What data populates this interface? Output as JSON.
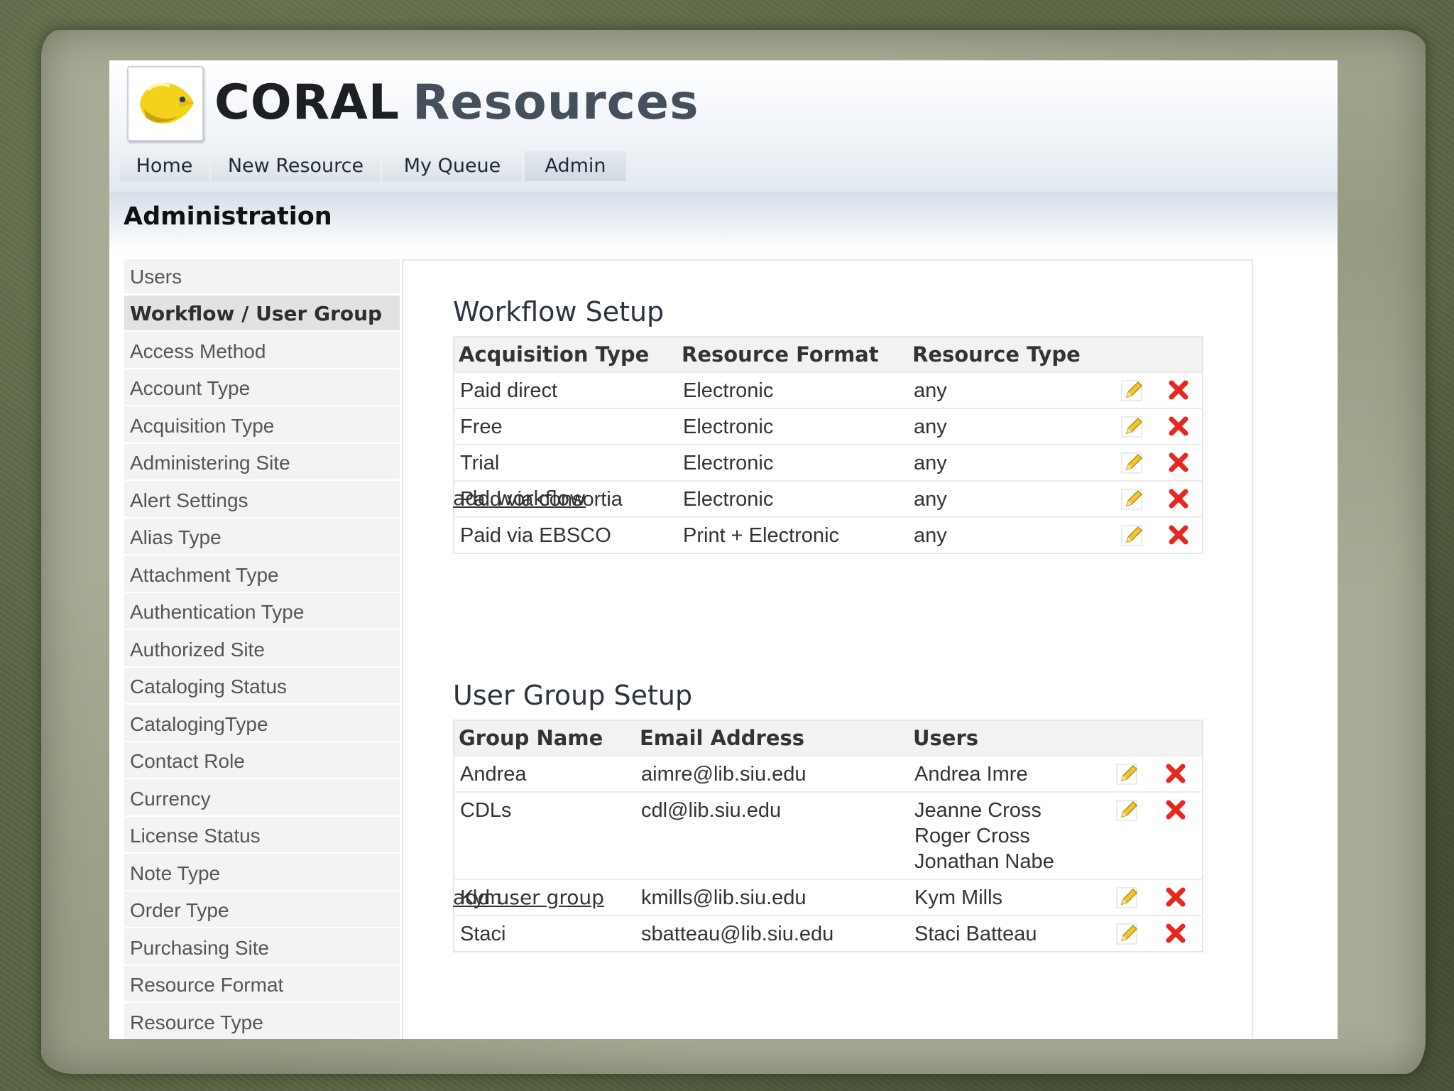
{
  "app": {
    "brand_primary": "CORAL",
    "brand_secondary": "Resources"
  },
  "nav": {
    "items": [
      {
        "label": "Home"
      },
      {
        "label": "New Resource"
      },
      {
        "label": "My Queue"
      },
      {
        "label": "Admin"
      }
    ],
    "active": "Admin"
  },
  "page": {
    "title": "Administration"
  },
  "sidebar": {
    "active": "Workflow / User Group",
    "items": [
      {
        "label": "Users"
      },
      {
        "label": "Workflow / User Group"
      },
      {
        "label": "Access Method"
      },
      {
        "label": "Account Type"
      },
      {
        "label": "Acquisition Type"
      },
      {
        "label": "Administering Site"
      },
      {
        "label": "Alert Settings"
      },
      {
        "label": "Alias Type"
      },
      {
        "label": "Attachment Type"
      },
      {
        "label": "Authentication Type"
      },
      {
        "label": "Authorized Site"
      },
      {
        "label": "Cataloging Status"
      },
      {
        "label": "CatalogingType"
      },
      {
        "label": "Contact Role"
      },
      {
        "label": "Currency"
      },
      {
        "label": "License Status"
      },
      {
        "label": "Note Type"
      },
      {
        "label": "Order Type"
      },
      {
        "label": "Purchasing Site"
      },
      {
        "label": "Resource Format"
      },
      {
        "label": "Resource Type"
      }
    ]
  },
  "workflow": {
    "title": "Workflow Setup",
    "headers": {
      "acquisition_type": "Acquisition Type",
      "resource_format": "Resource Format",
      "resource_type": "Resource Type"
    },
    "rows": [
      {
        "acquisition_type": "Paid direct",
        "resource_format": "Electronic",
        "resource_type": "any"
      },
      {
        "acquisition_type": "Free",
        "resource_format": "Electronic",
        "resource_type": "any"
      },
      {
        "acquisition_type": "Trial",
        "resource_format": "Electronic",
        "resource_type": "any"
      },
      {
        "acquisition_type": "Paid via consortia",
        "resource_format": "Electronic",
        "resource_type": "any"
      },
      {
        "acquisition_type": "Paid via EBSCO",
        "resource_format": "Print + Electronic",
        "resource_type": "any"
      }
    ],
    "add_label": "add workflow"
  },
  "user_groups": {
    "title": "User Group Setup",
    "headers": {
      "group_name": "Group Name",
      "email": "Email Address",
      "users": "Users"
    },
    "rows": [
      {
        "group_name": "Andrea",
        "email": "aimre@lib.siu.edu",
        "users": [
          "Andrea Imre"
        ]
      },
      {
        "group_name": "CDLs",
        "email": "cdl@lib.siu.edu",
        "users": [
          "Jeanne Cross",
          "Roger Cross",
          "Jonathan Nabe"
        ]
      },
      {
        "group_name": "Kym",
        "email": "kmills@lib.siu.edu",
        "users": [
          "Kym Mills"
        ]
      },
      {
        "group_name": "Staci",
        "email": "sbatteau@lib.siu.edu",
        "users": [
          "Staci Batteau"
        ]
      }
    ],
    "add_label": "add user group"
  },
  "icons": {
    "edit": "pencil-icon",
    "delete": "red-x-delete-icon",
    "logo": "yellow-fish-logo-icon"
  },
  "colors": {
    "delete_red": "#e8281e",
    "pencil_yellow": "#f2c530",
    "backdrop": "#5a6645"
  }
}
